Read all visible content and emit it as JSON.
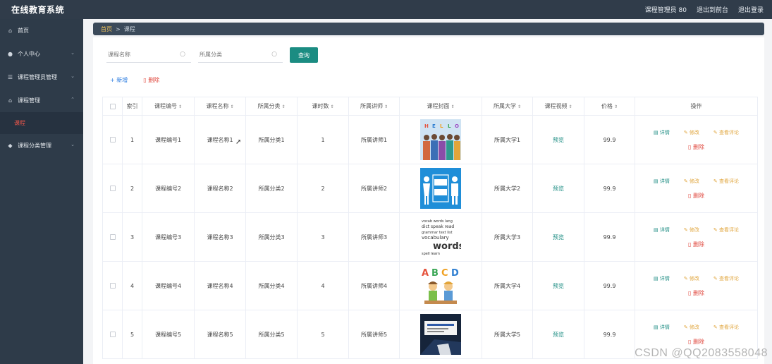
{
  "app": {
    "title": "在线教育系统",
    "user_label": "课程管理员 80",
    "exit_front": "退出到前台",
    "logout": "退出登录"
  },
  "sidebar": {
    "items": [
      {
        "label": "首页",
        "icon": "home-icon"
      },
      {
        "label": "个人中心",
        "icon": "user-icon"
      },
      {
        "label": "课程管理员管理",
        "icon": "sliders-icon"
      },
      {
        "label": "课程管理",
        "icon": "bank-icon"
      },
      {
        "label": "课程",
        "icon": ""
      },
      {
        "label": "课程分类管理",
        "icon": "tag-icon"
      }
    ]
  },
  "breadcrumb": {
    "home": "首页",
    "separator": ">",
    "current": "课程"
  },
  "search": {
    "name_placeholder": "课程名称",
    "category_placeholder": "所属分类",
    "query_label": "查询"
  },
  "actions": {
    "add_label": "+ 新增",
    "delete_label": "删除"
  },
  "table": {
    "headers": [
      "索引",
      "课程编号",
      "课程名称",
      "所属分类",
      "课时数",
      "所属讲师",
      "课程封面",
      "所属大学",
      "课程视频",
      "价格",
      "操作"
    ],
    "rows": [
      {
        "index": "1",
        "code": "课程编号1",
        "name": "课程名称1",
        "category": "所属分类1",
        "hours": "1",
        "teacher": "所属讲师1",
        "university": "所属大学1",
        "video": "预览",
        "price": "99.9"
      },
      {
        "index": "2",
        "code": "课程编号2",
        "name": "课程名称2",
        "category": "所属分类2",
        "hours": "2",
        "teacher": "所属讲师2",
        "university": "所属大学2",
        "video": "预览",
        "price": "99.9"
      },
      {
        "index": "3",
        "code": "课程编号3",
        "name": "课程名称3",
        "category": "所属分类3",
        "hours": "3",
        "teacher": "所属讲师3",
        "university": "所属大学3",
        "video": "预览",
        "price": "99.9"
      },
      {
        "index": "4",
        "code": "课程编号4",
        "name": "课程名称4",
        "category": "所属分类4",
        "hours": "4",
        "teacher": "所属讲师4",
        "university": "所属大学4",
        "video": "预览",
        "price": "99.9"
      },
      {
        "index": "5",
        "code": "课程编号5",
        "name": "课程名称5",
        "category": "所属分类5",
        "hours": "5",
        "teacher": "所属讲师5",
        "university": "所属大学5",
        "video": "预览",
        "price": "99.9"
      }
    ],
    "ops": {
      "detail": "详情",
      "edit": "修改",
      "review": "查看评论",
      "delete": "删除"
    }
  },
  "watermark": "CSDN @QQ2083558048"
}
